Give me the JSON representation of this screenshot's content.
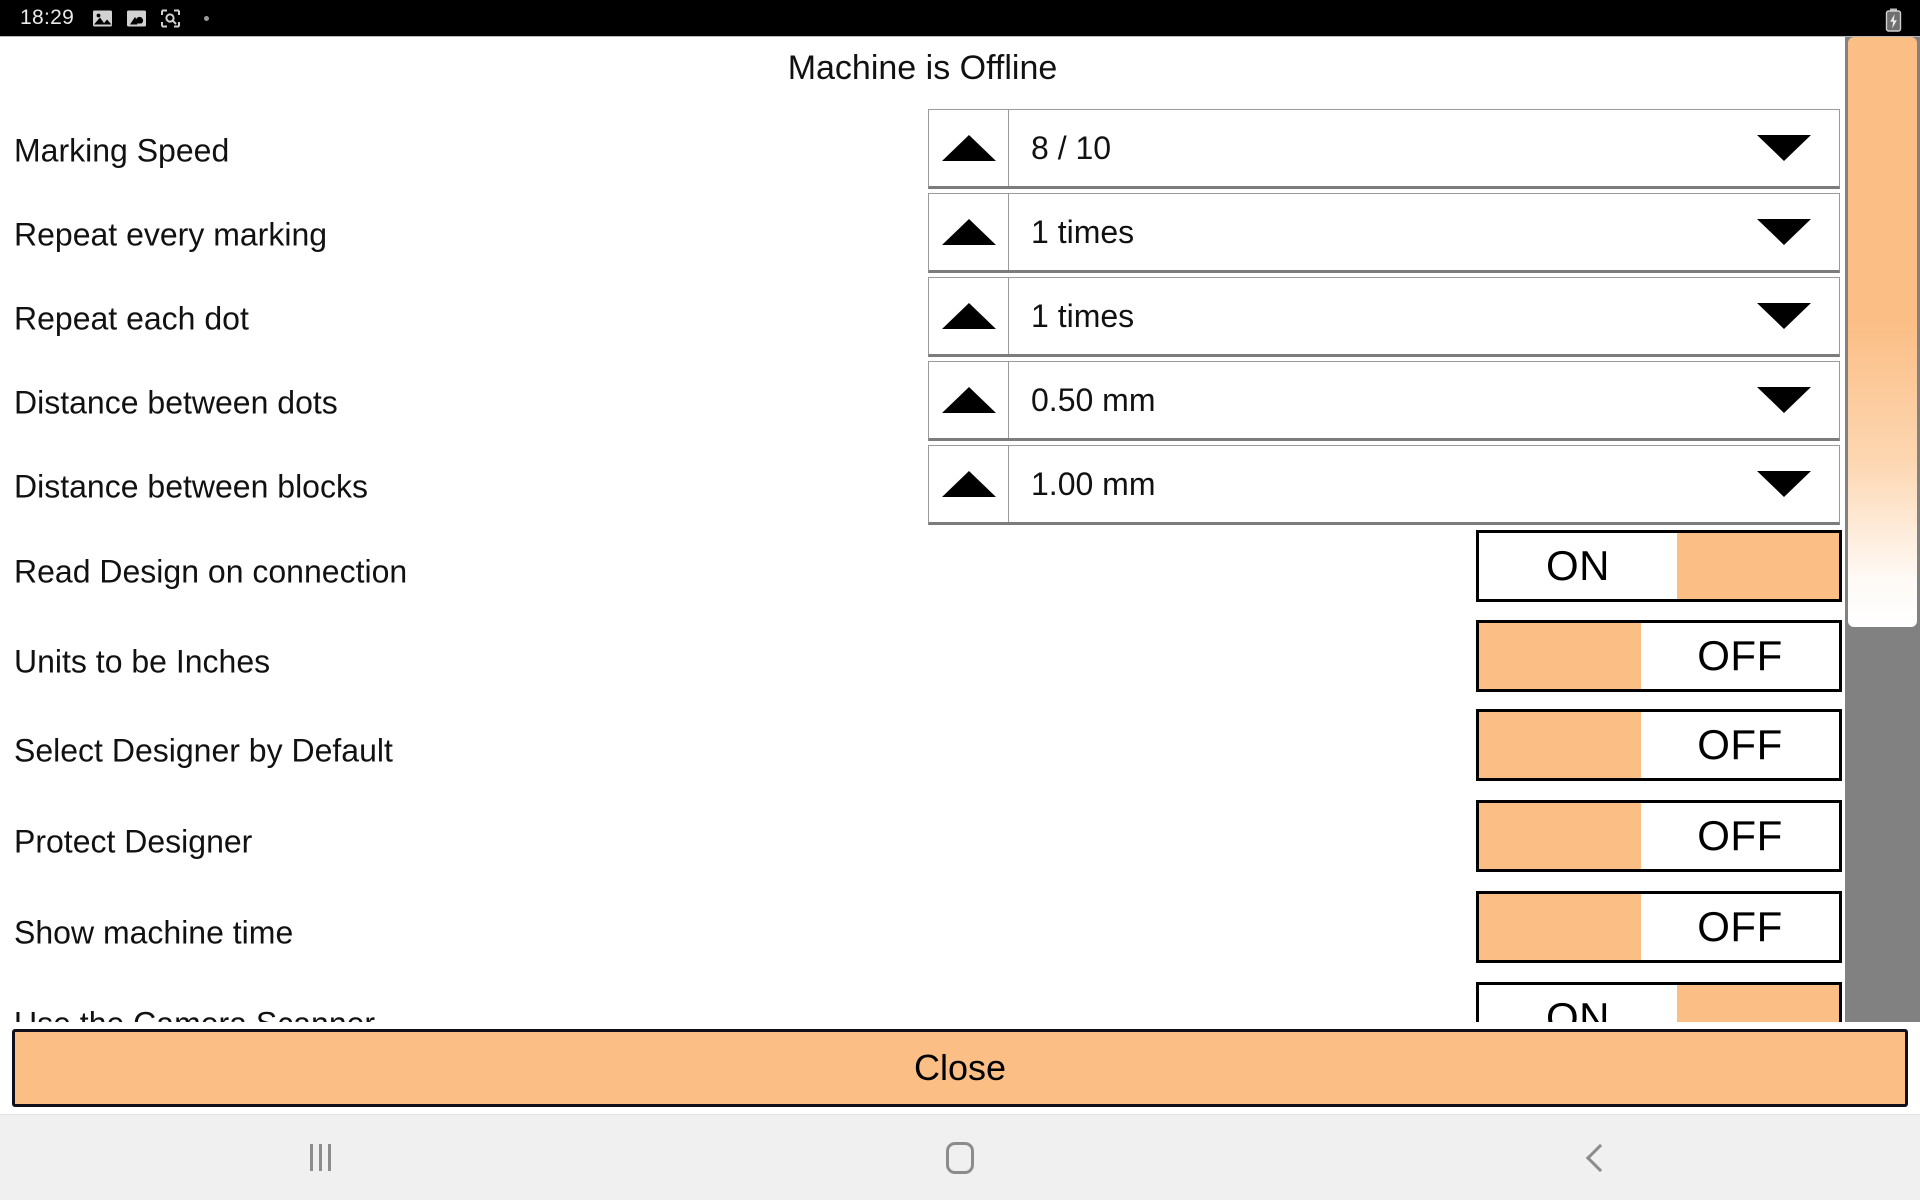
{
  "status_bar": {
    "time": "18:29",
    "icons": [
      "image-icon",
      "gallery-save-icon",
      "screenshot-search-icon"
    ],
    "battery_icon": "battery-charging-icon"
  },
  "panel": {
    "title": "Machine is Offline",
    "spinner_rows": [
      {
        "label": "Marking Speed",
        "value": "8 / 10",
        "up_icon": "triangle-up-icon",
        "down_icon": "triangle-down-icon"
      },
      {
        "label": "Repeat every marking",
        "value": "1 times",
        "up_icon": "triangle-up-icon",
        "down_icon": "triangle-down-icon"
      },
      {
        "label": "Repeat each dot",
        "value": "1 times",
        "up_icon": "triangle-up-icon",
        "down_icon": "triangle-down-icon"
      },
      {
        "label": "Distance between dots",
        "value": "0.50 mm",
        "up_icon": "triangle-up-icon",
        "down_icon": "triangle-down-icon"
      },
      {
        "label": "Distance between blocks",
        "value": "1.00 mm",
        "up_icon": "triangle-up-icon",
        "down_icon": "triangle-down-icon"
      }
    ],
    "toggle_rows": [
      {
        "label": "Read Design on connection",
        "state": "ON"
      },
      {
        "label": "Units to be Inches",
        "state": "OFF"
      },
      {
        "label": "Select Designer by Default",
        "state": "OFF"
      },
      {
        "label": "Protect Designer",
        "state": "OFF"
      },
      {
        "label": "Show machine time",
        "state": "OFF"
      },
      {
        "label": "Use the Camera Scanner",
        "state": "ON"
      }
    ],
    "scrollbar": {
      "name": "vertical-scrollbar",
      "thumb_position_percent": 0
    }
  },
  "footer": {
    "close_label": "Close"
  },
  "nav_bar": {
    "recents_icon": "recents-icon",
    "home_icon": "home-icon",
    "back_icon": "back-icon"
  },
  "colors": {
    "accent_orange": "#fbbe85",
    "panel_background": "#ffffff",
    "status_bar_background": "#000000",
    "nav_bar_background": "#f0f0f0",
    "scroll_track": "#818181"
  }
}
